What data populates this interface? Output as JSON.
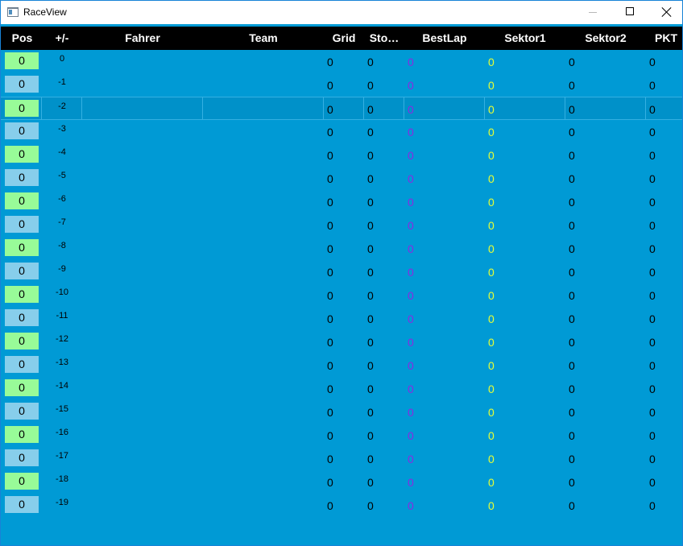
{
  "window": {
    "title": "RaceView",
    "icon": "app-window-icon",
    "controls": {
      "minimize": "minimize-icon",
      "maximize": "maximize-icon",
      "close": "close-icon"
    }
  },
  "colors": {
    "background": "#009ad5",
    "header_bg": "#000000",
    "header_text": "#ffffff",
    "pos_green": "#98fb98",
    "pos_blue": "#87ceeb",
    "bestlap_text": "#8a2be2",
    "sektor1_text": "#e8ff34"
  },
  "table": {
    "columns": {
      "pos": "Pos",
      "diff": "+/-",
      "driver": "Fahrer",
      "team": "Team",
      "grid": "Grid",
      "stops": "Sto…",
      "bestlap": "BestLap",
      "sektor1": "Sektor1",
      "sektor2": "Sektor2",
      "pkt": "PKT"
    },
    "rows": [
      {
        "pos": "0",
        "diff": "0",
        "driver": "",
        "team": "",
        "grid": "0",
        "stops": "0",
        "bestlap": "0",
        "sektor1": "0",
        "sektor2": "0",
        "pkt": "0",
        "pos_color": "green"
      },
      {
        "pos": "0",
        "diff": "-1",
        "driver": "",
        "team": "",
        "grid": "0",
        "stops": "0",
        "bestlap": "0",
        "sektor1": "0",
        "sektor2": "0",
        "pkt": "0",
        "pos_color": "blue"
      },
      {
        "pos": "0",
        "diff": "-2",
        "driver": "",
        "team": "",
        "grid": "0",
        "stops": "0",
        "bestlap": "0",
        "sektor1": "0",
        "sektor2": "0",
        "pkt": "0",
        "pos_color": "green",
        "selected": true
      },
      {
        "pos": "0",
        "diff": "-3",
        "driver": "",
        "team": "",
        "grid": "0",
        "stops": "0",
        "bestlap": "0",
        "sektor1": "0",
        "sektor2": "0",
        "pkt": "0",
        "pos_color": "blue"
      },
      {
        "pos": "0",
        "diff": "-4",
        "driver": "",
        "team": "",
        "grid": "0",
        "stops": "0",
        "bestlap": "0",
        "sektor1": "0",
        "sektor2": "0",
        "pkt": "0",
        "pos_color": "green"
      },
      {
        "pos": "0",
        "diff": "-5",
        "driver": "",
        "team": "",
        "grid": "0",
        "stops": "0",
        "bestlap": "0",
        "sektor1": "0",
        "sektor2": "0",
        "pkt": "0",
        "pos_color": "blue"
      },
      {
        "pos": "0",
        "diff": "-6",
        "driver": "",
        "team": "",
        "grid": "0",
        "stops": "0",
        "bestlap": "0",
        "sektor1": "0",
        "sektor2": "0",
        "pkt": "0",
        "pos_color": "green"
      },
      {
        "pos": "0",
        "diff": "-7",
        "driver": "",
        "team": "",
        "grid": "0",
        "stops": "0",
        "bestlap": "0",
        "sektor1": "0",
        "sektor2": "0",
        "pkt": "0",
        "pos_color": "blue"
      },
      {
        "pos": "0",
        "diff": "-8",
        "driver": "",
        "team": "",
        "grid": "0",
        "stops": "0",
        "bestlap": "0",
        "sektor1": "0",
        "sektor2": "0",
        "pkt": "0",
        "pos_color": "green"
      },
      {
        "pos": "0",
        "diff": "-9",
        "driver": "",
        "team": "",
        "grid": "0",
        "stops": "0",
        "bestlap": "0",
        "sektor1": "0",
        "sektor2": "0",
        "pkt": "0",
        "pos_color": "blue"
      },
      {
        "pos": "0",
        "diff": "-10",
        "driver": "",
        "team": "",
        "grid": "0",
        "stops": "0",
        "bestlap": "0",
        "sektor1": "0",
        "sektor2": "0",
        "pkt": "0",
        "pos_color": "green"
      },
      {
        "pos": "0",
        "diff": "-11",
        "driver": "",
        "team": "",
        "grid": "0",
        "stops": "0",
        "bestlap": "0",
        "sektor1": "0",
        "sektor2": "0",
        "pkt": "0",
        "pos_color": "blue"
      },
      {
        "pos": "0",
        "diff": "-12",
        "driver": "",
        "team": "",
        "grid": "0",
        "stops": "0",
        "bestlap": "0",
        "sektor1": "0",
        "sektor2": "0",
        "pkt": "0",
        "pos_color": "green"
      },
      {
        "pos": "0",
        "diff": "-13",
        "driver": "",
        "team": "",
        "grid": "0",
        "stops": "0",
        "bestlap": "0",
        "sektor1": "0",
        "sektor2": "0",
        "pkt": "0",
        "pos_color": "blue"
      },
      {
        "pos": "0",
        "diff": "-14",
        "driver": "",
        "team": "",
        "grid": "0",
        "stops": "0",
        "bestlap": "0",
        "sektor1": "0",
        "sektor2": "0",
        "pkt": "0",
        "pos_color": "green"
      },
      {
        "pos": "0",
        "diff": "-15",
        "driver": "",
        "team": "",
        "grid": "0",
        "stops": "0",
        "bestlap": "0",
        "sektor1": "0",
        "sektor2": "0",
        "pkt": "0",
        "pos_color": "blue"
      },
      {
        "pos": "0",
        "diff": "-16",
        "driver": "",
        "team": "",
        "grid": "0",
        "stops": "0",
        "bestlap": "0",
        "sektor1": "0",
        "sektor2": "0",
        "pkt": "0",
        "pos_color": "green"
      },
      {
        "pos": "0",
        "diff": "-17",
        "driver": "",
        "team": "",
        "grid": "0",
        "stops": "0",
        "bestlap": "0",
        "sektor1": "0",
        "sektor2": "0",
        "pkt": "0",
        "pos_color": "blue"
      },
      {
        "pos": "0",
        "diff": "-18",
        "driver": "",
        "team": "",
        "grid": "0",
        "stops": "0",
        "bestlap": "0",
        "sektor1": "0",
        "sektor2": "0",
        "pkt": "0",
        "pos_color": "green"
      },
      {
        "pos": "0",
        "diff": "-19",
        "driver": "",
        "team": "",
        "grid": "0",
        "stops": "0",
        "bestlap": "0",
        "sektor1": "0",
        "sektor2": "0",
        "pkt": "0",
        "pos_color": "blue"
      }
    ]
  }
}
